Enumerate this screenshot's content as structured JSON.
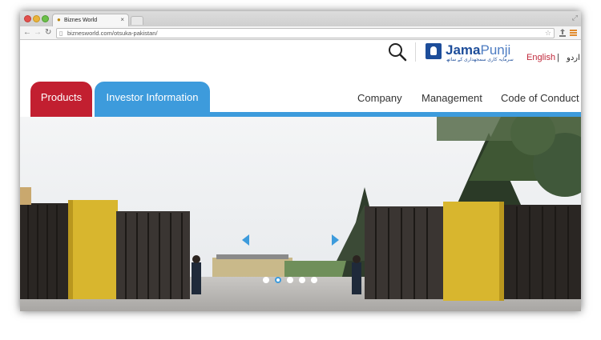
{
  "browser": {
    "tab_title": "Biznes World",
    "tab_close": "×",
    "url": "biznesworld.com/otsuka-pakistan/"
  },
  "header": {
    "logo_jama": "Jama",
    "logo_punji": "Punji",
    "logo_tagline": "سرمایہ کاری سمجھداری کے ساتھ",
    "lang_english": "English",
    "lang_separator": "|",
    "lang_urdu": "اردو"
  },
  "nav": {
    "products": "Products",
    "investor_information": "Investor Information",
    "company": "Company",
    "management": "Management",
    "code_of_conduct": "Code of Conduct"
  },
  "slider": {
    "slide_count": 5,
    "active_index": 1
  },
  "colors": {
    "brand_red": "#c21f30",
    "brand_blue": "#3d9bdc",
    "logo_blue": "#1d4d9a"
  }
}
